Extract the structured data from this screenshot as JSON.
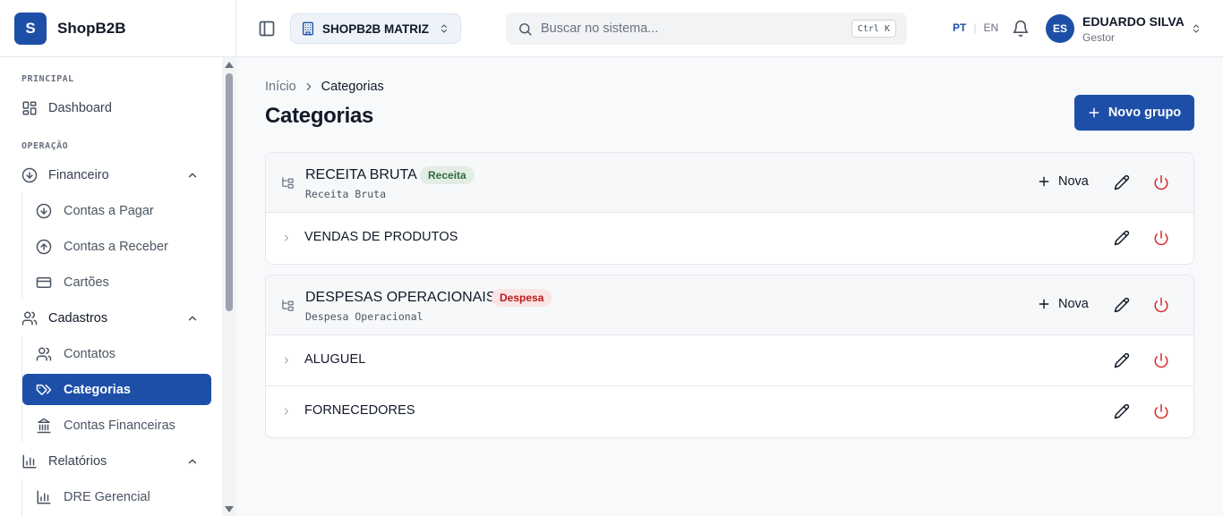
{
  "brand": {
    "logo_letter": "S",
    "name": "ShopB2B"
  },
  "sidebar": {
    "sections": [
      {
        "label": "PRINCIPAL"
      },
      {
        "label": "OPERAÇÃO"
      }
    ],
    "dashboard": {
      "label": "Dashboard",
      "icon": "dashboard-icon"
    },
    "financeiro": {
      "label": "Financeiro",
      "icon": "arrow-down-circle-icon",
      "expanded": true,
      "items": [
        {
          "label": "Contas a Pagar",
          "icon": "arrow-down-circle-icon"
        },
        {
          "label": "Contas a Receber",
          "icon": "arrow-up-circle-icon"
        },
        {
          "label": "Cartões",
          "icon": "credit-card-icon"
        }
      ]
    },
    "cadastros": {
      "label": "Cadastros",
      "icon": "users-icon",
      "expanded": true,
      "items": [
        {
          "label": "Contatos",
          "icon": "users-icon"
        },
        {
          "label": "Categorias",
          "icon": "tags-icon",
          "active": true
        },
        {
          "label": "Contas Financeiras",
          "icon": "bank-icon"
        }
      ]
    },
    "relatorios": {
      "label": "Relatórios",
      "icon": "bar-chart-icon",
      "expanded": true,
      "items": [
        {
          "label": "DRE Gerencial",
          "icon": "bar-chart-icon"
        }
      ]
    }
  },
  "header": {
    "company": "SHOPB2B MATRIZ",
    "search": {
      "placeholder": "Buscar no sistema...",
      "shortcut": "Ctrl K"
    },
    "lang": {
      "active": "PT",
      "separator": "|",
      "other": "EN"
    },
    "user": {
      "initials": "ES",
      "name": "EDUARDO SILVA",
      "role": "Gestor"
    }
  },
  "breadcrumb": {
    "home": "Início",
    "current": "Categorias"
  },
  "page": {
    "title": "Categorias",
    "new_group_label": "Novo grupo"
  },
  "groups": [
    {
      "title": "RECEITA BRUTA",
      "badge": "Receita",
      "badge_type": "receita",
      "code": "Receita Bruta",
      "new_label": "Nova",
      "rows": [
        {
          "name": "VENDAS DE PRODUTOS"
        }
      ]
    },
    {
      "title": "DESPESAS OPERACIONAIS",
      "badge": "Despesa",
      "badge_type": "despesa",
      "code": "Despesa Operacional",
      "new_label": "Nova",
      "rows": [
        {
          "name": "ALUGUEL"
        },
        {
          "name": "FORNECEDORES"
        }
      ]
    }
  ],
  "colors": {
    "primary": "#1d4fa8",
    "danger": "#dc2626",
    "receita_bg": "#e3ede5",
    "despesa_bg": "#fbe4e4"
  }
}
